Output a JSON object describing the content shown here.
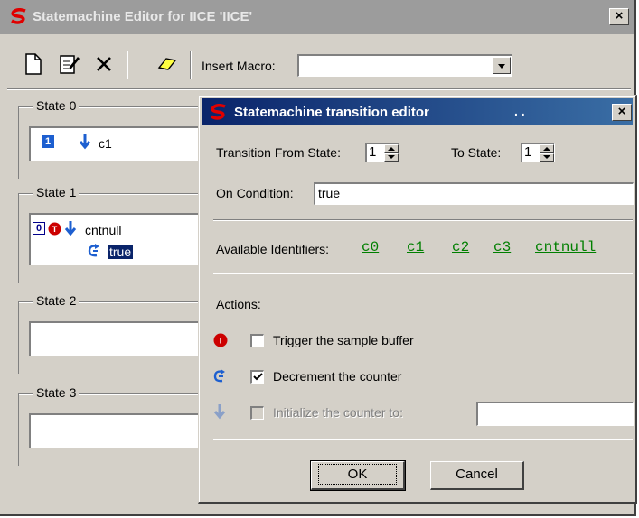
{
  "main_window": {
    "title": "Statemachine Editor for IICE 'IICE'",
    "close_label": "×"
  },
  "toolbar": {
    "insert_macro_label": "Insert Macro:",
    "insert_macro_value": ""
  },
  "states": [
    {
      "label": "State 0",
      "number": "1",
      "text": "c1"
    },
    {
      "label": "State 1",
      "number": "0",
      "text": "cntnull",
      "subtext": "true"
    },
    {
      "label": "State 2"
    },
    {
      "label": "State 3"
    }
  ],
  "dialog": {
    "title": "Statemachine transition editor",
    "title_dots": ". .",
    "close_label": "×",
    "from_label": "Transition From State:",
    "from_value": "1",
    "to_label": "To State:",
    "to_value": "1",
    "condition_label": "On Condition:",
    "condition_value": "true",
    "identifiers_label": "Available Identifiers:",
    "identifiers": [
      "c0",
      "c1",
      "c2",
      "c3",
      "cntnull"
    ],
    "actions_label": "Actions:",
    "actions": [
      {
        "label": "Trigger the sample buffer",
        "checked": false,
        "enabled": true,
        "icon": "trigger-icon"
      },
      {
        "label": "Decrement the counter",
        "checked": true,
        "enabled": true,
        "icon": "decrement-icon"
      },
      {
        "label": "Initialize the counter to:",
        "checked": false,
        "enabled": false,
        "icon": "init-counter-icon",
        "value": ""
      }
    ],
    "ok_label": "OK",
    "cancel_label": "Cancel"
  },
  "colors": {
    "title_active_start": "#0a246a",
    "title_active_end": "#3a6ea5",
    "title_inactive": "#9c9c9c",
    "identifier_link": "#007f00",
    "selection": "#0a246a"
  }
}
